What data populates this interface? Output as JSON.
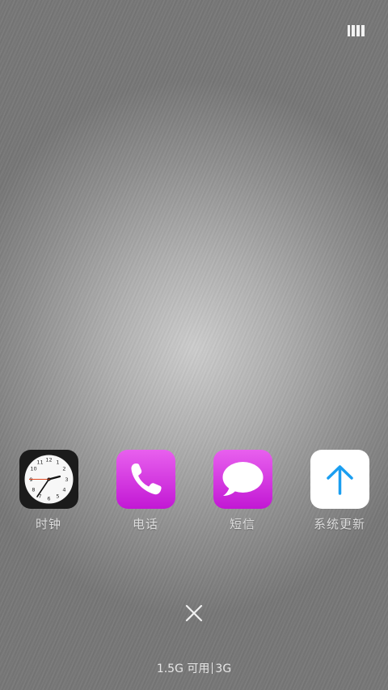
{
  "toolbar": {
    "layout_toggle_icon": "grid-layout-icon"
  },
  "apps": [
    {
      "label": "时钟",
      "icon": "clock-icon"
    },
    {
      "label": "电话",
      "icon": "phone-icon"
    },
    {
      "label": "短信",
      "icon": "message-icon"
    },
    {
      "label": "系统更新",
      "icon": "update-arrow-icon"
    }
  ],
  "clock_face": {
    "numbers": [
      "12",
      "1",
      "2",
      "3",
      "4",
      "5",
      "6",
      "7",
      "8",
      "9",
      "10",
      "11"
    ]
  },
  "close_icon": "close-icon",
  "memory": {
    "available": "1.5G 可用",
    "network": "3G"
  },
  "colors": {
    "accent_magenta": "#d83ae0",
    "update_arrow": "#1a9ef0",
    "label_text": "#dcdcdc"
  }
}
